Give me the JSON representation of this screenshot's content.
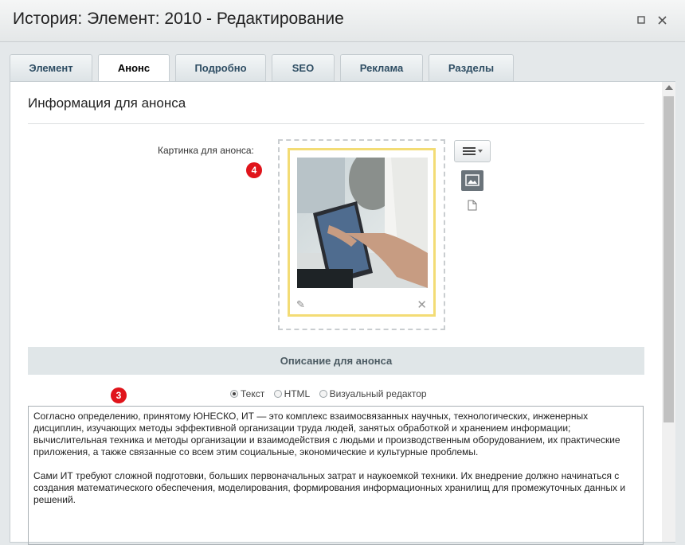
{
  "window": {
    "title": "История: Элемент: 2010 - Редактирование"
  },
  "tabs": [
    {
      "label": "Элемент"
    },
    {
      "label": "Анонс"
    },
    {
      "label": "Подробно"
    },
    {
      "label": "SEO"
    },
    {
      "label": "Реклама"
    },
    {
      "label": "Разделы"
    }
  ],
  "active_tab": "Анонс",
  "section": {
    "title": "Информация для анонса"
  },
  "image_field": {
    "label": "Картинка для анонса:",
    "badge": "4"
  },
  "description": {
    "header": "Описание для анонса",
    "badge": "3",
    "modes": [
      {
        "label": "Текст",
        "selected": true
      },
      {
        "label": "HTML",
        "selected": false
      },
      {
        "label": "Визуальный редактор",
        "selected": false
      }
    ],
    "paragraphs": [
      "Согласно определению, принятому ЮНЕСКО, ИТ — это комплекс взаимосвязанных научных, технологических, инженерных дисциплин, изучающих методы эффективной организации труда людей, занятых обработкой и хранением информации; вычислительная техника и методы организации и взаимодействия с людьми и производственным оборудованием, их практические приложения, а также связанные со всем этим социальные, экономические и культурные проблемы.",
      "Сами ИТ требуют сложной подготовки, больших первоначальных затрат и наукоемкой техники. Их внедрение должно начинаться с создания математического обеспечения, моделирования, формирования информационных хранилищ для промежуточных данных и решений."
    ]
  },
  "colors": {
    "badge": "#e0141b",
    "image_frame": "#f3dc75",
    "tab_text": "#2e4d63"
  },
  "icons": [
    "restore-icon",
    "close-icon",
    "edit-icon",
    "delete-icon",
    "menu-icon",
    "image-icon",
    "file-icon"
  ]
}
